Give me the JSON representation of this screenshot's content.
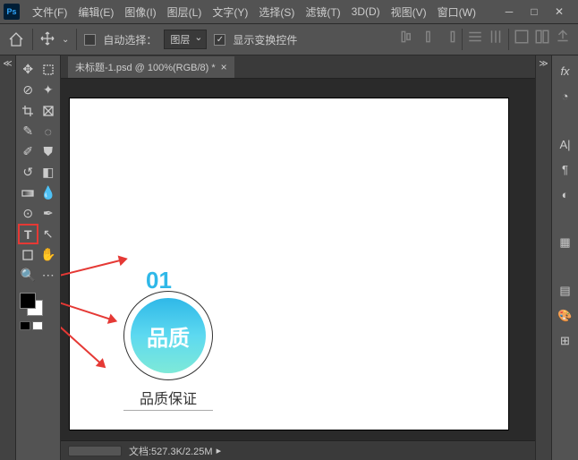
{
  "app": {
    "logo": "Ps"
  },
  "menu": [
    "文件(F)",
    "编辑(E)",
    "图像(I)",
    "图层(L)",
    "文字(Y)",
    "选择(S)",
    "滤镜(T)",
    "3D(D)",
    "视图(V)",
    "窗口(W)"
  ],
  "options": {
    "autoSelectLabel": "自动选择：",
    "autoSelectChecked": false,
    "layerDropdown": "图层",
    "transformLabel": "显示变换控件",
    "transformChecked": true
  },
  "tab": {
    "title": "未标题-1.psd @ 100%(RGB/8) *",
    "close": "×"
  },
  "canvas": {
    "number": "01",
    "circleText": "品质",
    "caption": "品质保证"
  },
  "status": {
    "docInfo": "文档:527.3K/2.25M"
  },
  "tools": {
    "leftColumn": [
      "move",
      "marquee",
      "lasso",
      "wand",
      "crop",
      "frame",
      "eyedropper",
      "patch",
      "brush",
      "stamp",
      "history",
      "eraser",
      "gradient",
      "blur",
      "dodge",
      "pen",
      "type",
      "path",
      "shape",
      "hand",
      "zoom"
    ],
    "rightPanels": [
      "fx",
      "color-wheel",
      "char",
      "para",
      "brushset",
      "swatch",
      "layers",
      "palette",
      "grid"
    ]
  },
  "colors": {
    "fg": "#000000",
    "bg": "#ffffff"
  }
}
